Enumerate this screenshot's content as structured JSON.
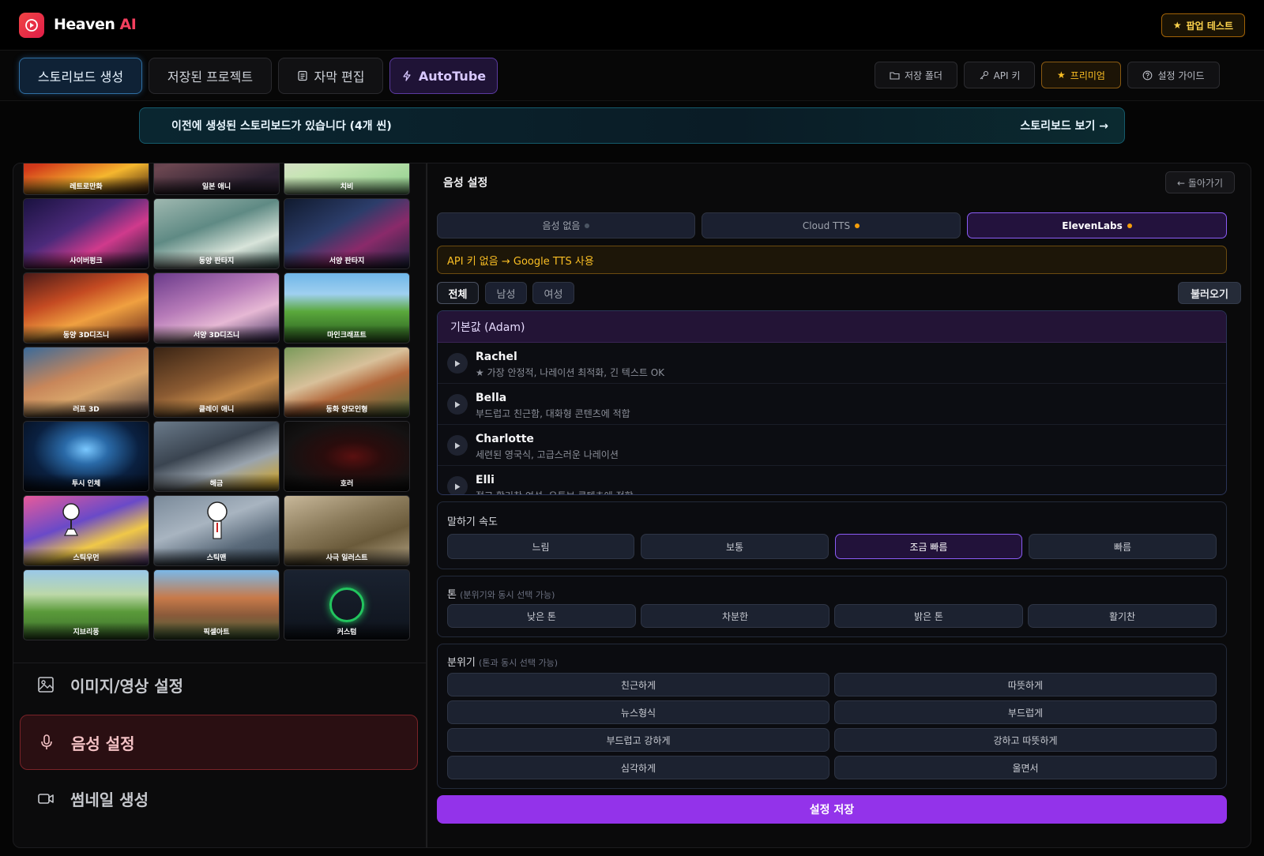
{
  "app": {
    "name_main": "Heaven",
    "name_accent": "AI",
    "popup_test": "팝업 테스트"
  },
  "nav": {
    "tabs": [
      {
        "label": "스토리보드 생성"
      },
      {
        "label": "저장된 프로젝트"
      },
      {
        "label": "자막 편집"
      },
      {
        "label": "AutoTube"
      }
    ],
    "right": [
      {
        "label": "저장 폴더"
      },
      {
        "label": "API 키"
      },
      {
        "label": "프리미엄"
      },
      {
        "label": "설정 가이드"
      }
    ]
  },
  "banner": {
    "text": "이전에 생성된 스토리보드가 있습니다 (4개 씬)",
    "action": "스토리보드 보기 →"
  },
  "styles": [
    {
      "label": "레트로만화"
    },
    {
      "label": "일본 애니"
    },
    {
      "label": "치비"
    },
    {
      "label": "사이버펑크"
    },
    {
      "label": "동양 판타지"
    },
    {
      "label": "서양 판타지"
    },
    {
      "label": "동양 3D디즈니"
    },
    {
      "label": "서양 3D디즈니"
    },
    {
      "label": "마인크래프트"
    },
    {
      "label": "러프 3D"
    },
    {
      "label": "클레이 애니"
    },
    {
      "label": "동화 양모인형"
    },
    {
      "label": "투시 인체"
    },
    {
      "label": "해금"
    },
    {
      "label": "호러"
    },
    {
      "label": "스틱우먼"
    },
    {
      "label": "스틱맨"
    },
    {
      "label": "사극 일러스트"
    },
    {
      "label": "지브리풍"
    },
    {
      "label": "픽셀아트"
    },
    {
      "label": "커스텀"
    }
  ],
  "side_menu": [
    {
      "label": "이미지/영상 설정"
    },
    {
      "label": "음성 설정"
    },
    {
      "label": "썸네일 생성"
    }
  ],
  "voice": {
    "title": "음성 설정",
    "back": "← 돌아가기",
    "engines": [
      {
        "label": "음성 없음"
      },
      {
        "label": "Cloud TTS"
      },
      {
        "label": "ElevenLabs"
      }
    ],
    "warning": "API 키 없음 → Google TTS 사용",
    "genders": [
      {
        "label": "전체"
      },
      {
        "label": "남성"
      },
      {
        "label": "여성"
      }
    ],
    "load": "불러오기",
    "default_voice": "기본값 (Adam)",
    "voices": [
      {
        "name": "Rachel",
        "desc": "★ 가장 안정적, 나레이션 최적화, 긴 텍스트 OK"
      },
      {
        "name": "Bella",
        "desc": "부드럽고 친근함, 대화형 콘텐츠에 적합"
      },
      {
        "name": "Charlotte",
        "desc": "세련된 영국식, 고급스러운 나레이션"
      },
      {
        "name": "Elli",
        "desc": "젊고 활기찬 여성, 유튜브 콘텐츠에 적합"
      }
    ],
    "speed": {
      "title": "말하기 속도",
      "options": [
        "느림",
        "보통",
        "조금 빠름",
        "빠름"
      ],
      "selected": "조금 빠름"
    },
    "tone": {
      "title": "톤",
      "sub": "(분위기와 동시 선택 가능)",
      "options": [
        "낮은 톤",
        "차분한",
        "밝은 톤",
        "활기찬"
      ]
    },
    "mood": {
      "title": "분위기",
      "sub": "(톤과 동시 선택 가능)",
      "options": [
        "친근하게",
        "따뜻하게",
        "뉴스형식",
        "부드럽게",
        "부드럽고 강하게",
        "강하고 따뜻하게",
        "심각하게",
        "울면서"
      ]
    },
    "save": "설정 저장"
  },
  "colors": {
    "accent_purple": "#9333ea",
    "accent_red": "#ef4444",
    "accent_amber": "#fbbf24"
  }
}
